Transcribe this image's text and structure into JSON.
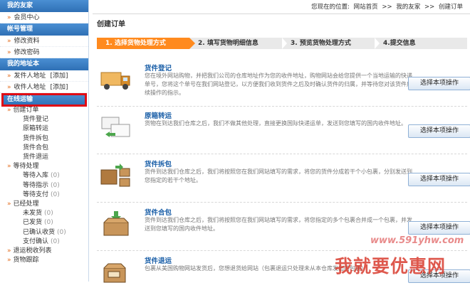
{
  "sidebar": {
    "my_home": {
      "heading": "我的友家",
      "items": [
        {
          "label": "会员中心"
        }
      ]
    },
    "account": {
      "heading": "帐号管理",
      "items": [
        {
          "label": "修改资料"
        },
        {
          "label": "修改密码"
        }
      ]
    },
    "address": {
      "heading": "我的地址本",
      "items": [
        {
          "label": "发件人地址",
          "add": "[添加]"
        },
        {
          "label": "收件人地址",
          "add": "[添加]"
        }
      ]
    },
    "online": {
      "heading": "在线运输",
      "create_order": "创建订单",
      "create_children": [
        "货件登记",
        "原箱转运",
        "货件拆包",
        "货件合包",
        "货件退运"
      ],
      "pending": "等待处理",
      "pending_children": [
        {
          "label": "等待入库",
          "count": "(0)"
        },
        {
          "label": "等待指示",
          "count": "(0)"
        },
        {
          "label": "等待支付",
          "count": "(0)"
        }
      ],
      "processed": "已经处理",
      "processed_children": [
        {
          "label": "未发货",
          "count": "(0)"
        },
        {
          "label": "已发货",
          "count": "(0)"
        },
        {
          "label": "已确认收货",
          "count": "(0)"
        },
        {
          "label": "支付确认",
          "count": "(0)"
        }
      ],
      "return_list": "退运税收列表",
      "tracking": "货物跟踪"
    }
  },
  "breadcrumb": {
    "prefix": "您现在的位置:",
    "home": "网站首页",
    "sep1": ">>",
    "mine": "我的友家",
    "sep2": ">>",
    "current": "创建订单"
  },
  "page_title": "创建订单",
  "steps": [
    "1. 选择货物处理方式",
    "2. 填写货物明细信息",
    "3. 预览货物处理方式",
    "4.提交信息"
  ],
  "options": [
    {
      "title": "货件登记",
      "desc": "您在境外网站购物，并把我们公司的仓库地址作为您的收件地址，购物网站会给您提供一个当地运输的快递单号，您将这个单号在我们网站登记，以方便我们收到货件之后及时确认货件的归属，并等待您对该货件后续操作的指示。",
      "button": "选择本项操作"
    },
    {
      "title": "原箱转运",
      "desc": "货物在到达我们仓库之后，我们不做其他处理，直接更换国际快递运单，发送到您填写的国内收件地址。",
      "button": "选择本项操作"
    },
    {
      "title": "货件拆包",
      "desc": "货件到达我们仓库之后，我们将按照您在我们网站填写的需求，将您的货件分成若干个小包裹，分别发送到您指定的若干个地址。",
      "button": "选择本项操作"
    },
    {
      "title": "货件合包",
      "desc": "货件到达我们仓库之后，我们将按照您在我们网站填写的需求，将您指定的多个包裹合并成一个包裹，并发送到您填写的国内收件地址。",
      "button": "选择本项操作"
    },
    {
      "title": "货件退运",
      "desc": "包裹从美国购物网站发货后，您想退货给网站（包裹退运只处理未从本仓库发出的包裹）",
      "button": "选择本项操作"
    }
  ],
  "watermark": {
    "url": "www.591yhw.com",
    "text": "我就要优惠网"
  },
  "colors": {
    "sidebar_header": "#3a7fc4",
    "step_active": "#ff8a1e",
    "highlight_box": "#e00b14",
    "link_blue": "#1a5fa8"
  }
}
